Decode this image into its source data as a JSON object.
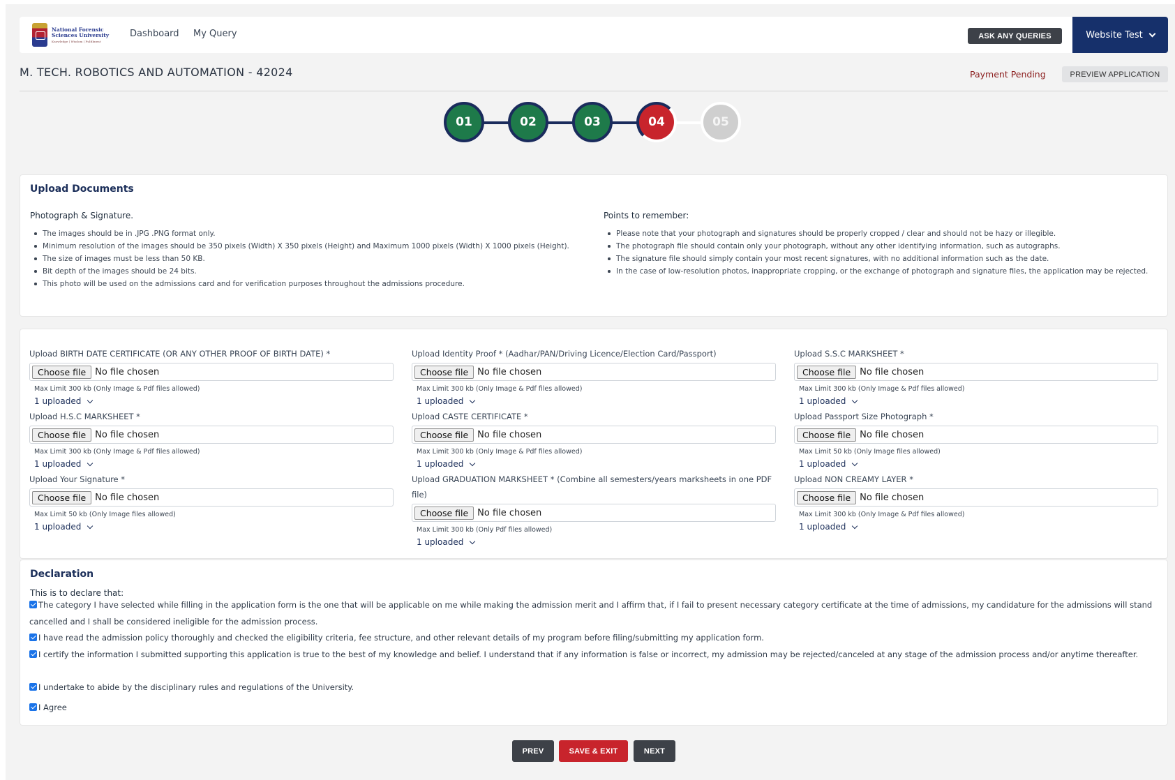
{
  "header": {
    "logo_line1": "National Forensic",
    "logo_line2": "Sciences University",
    "logo_tagline": "Knowledge | Wisdom | Fulfilment",
    "nav": [
      "Dashboard",
      "My Query"
    ],
    "ask_button": "ASK ANY QUERIES",
    "user_menu": "Website Test"
  },
  "program": {
    "title": "M. TECH. ROBOTICS AND AUTOMATION - 42024",
    "status": "Payment Pending",
    "preview_button": "PREVIEW APPLICATION"
  },
  "stepper": {
    "steps": [
      {
        "label": "01",
        "state": "done"
      },
      {
        "label": "02",
        "state": "done"
      },
      {
        "label": "03",
        "state": "done"
      },
      {
        "label": "04",
        "state": "current"
      },
      {
        "label": "05",
        "state": "todo"
      }
    ],
    "colors": {
      "done": "#1e7a4a",
      "current": "#c8242c",
      "todo": "#cfcfcf",
      "connector": "#1a2b5c"
    }
  },
  "upload_docs": {
    "title": "Upload Documents",
    "photo_heading": "Photograph & Signature.",
    "photo_points": [
      "The images should be in .JPG .PNG format only.",
      "Minimum resolution of the images should be 350 pixels (Width) X 350 pixels (Height) and Maximum 1000 pixels (Width) X 1000 pixels (Height).",
      "The size of images must be less than 50 KB.",
      "Bit depth of the images should be 24 bits.",
      "This photo will be used on the admissions card and for verification purposes throughout the admissions procedure."
    ],
    "remember_heading": "Points to remember:",
    "remember_points": [
      "Please note that your photograph and signatures should be properly cropped / clear and should not be hazy or illegible.",
      "The photograph file should contain only your photograph, without any other identifying information, such as autographs.",
      "The signature file should simply contain your most recent signatures, with no additional information such as the date.",
      "In the case of low-resolution photos, inappropriate cropping, or the exchange of photograph and signature files, the application may be rejected."
    ]
  },
  "uploads": {
    "choose_label": "Choose file",
    "no_file_text": "No file chosen",
    "fields": [
      {
        "label": "Upload BIRTH DATE CERTIFICATE (OR ANY OTHER PROOF OF BIRTH DATE) *",
        "hint": "Max Limit 300 kb (Only Image & Pdf files allowed)",
        "status": "1 uploaded"
      },
      {
        "label": "Upload Identity Proof * (Aadhar/PAN/Driving Licence/Election Card/Passport)",
        "hint": "Max Limit 300 kb (Only Image & Pdf files allowed)",
        "status": "1 uploaded"
      },
      {
        "label": "Upload S.S.C MARKSHEET *",
        "hint": "Max Limit 300 kb (Only Image & Pdf files allowed)",
        "status": "1 uploaded"
      },
      {
        "label": "Upload H.S.C MARKSHEET *",
        "hint": "Max Limit 300 kb (Only Image & Pdf files allowed)",
        "status": "1 uploaded"
      },
      {
        "label": "Upload CASTE CERTIFICATE *",
        "hint": "Max Limit 300 kb (Only Image & Pdf files allowed)",
        "status": "1 uploaded"
      },
      {
        "label": "Upload Passport Size Photograph *",
        "hint": "Max Limit 50 kb (Only Image files allowed)",
        "status": "1 uploaded"
      },
      {
        "label": "Upload Your Signature *",
        "hint": "Max Limit 50 kb (Only Image files allowed)",
        "status": "1 uploaded"
      },
      {
        "label": "Upload GRADUATION MARKSHEET * (Combine all semesters/years marksheets in one PDF file)",
        "hint": "Max Limit 300 kb (Only Pdf files allowed)",
        "status": "1 uploaded"
      },
      {
        "label": "Upload NON CREAMY LAYER *",
        "hint": "Max Limit 300 kb (Only Image & Pdf files allowed)",
        "status": "1 uploaded"
      }
    ]
  },
  "declaration": {
    "title": "Declaration",
    "intro": "This is to declare that:",
    "items": [
      {
        "text": "The category I have selected while filling in the application form is the one that will be applicable on me while making the admission merit and I affirm that, if I fail to present necessary category certificate at the time of admissions, my candidature for the admissions will stand cancelled and I shall be considered ineligible for the admission process.",
        "checked": true
      },
      {
        "text": "I have read the admission policy thoroughly and checked the eligibility criteria, fee structure, and other relevant details of my program before filing/submitting my application form.",
        "checked": true
      },
      {
        "text": "I certify the information I submitted supporting this application is true to the best of my knowledge and belief. I understand that if any information is false or incorrect, my admission may be rejected/canceled at any stage of the admission process and/or anytime thereafter.",
        "checked": true
      },
      {
        "text": "I undertake to abide by the disciplinary rules and regulations of the University.",
        "checked": true
      },
      {
        "text": "I Agree",
        "checked": true
      }
    ]
  },
  "actions": {
    "prev": "PREV",
    "save_exit": "SAVE & EXIT",
    "next": "NEXT",
    "colors": {
      "dark": "#3d4148",
      "danger": "#c8242c"
    }
  }
}
